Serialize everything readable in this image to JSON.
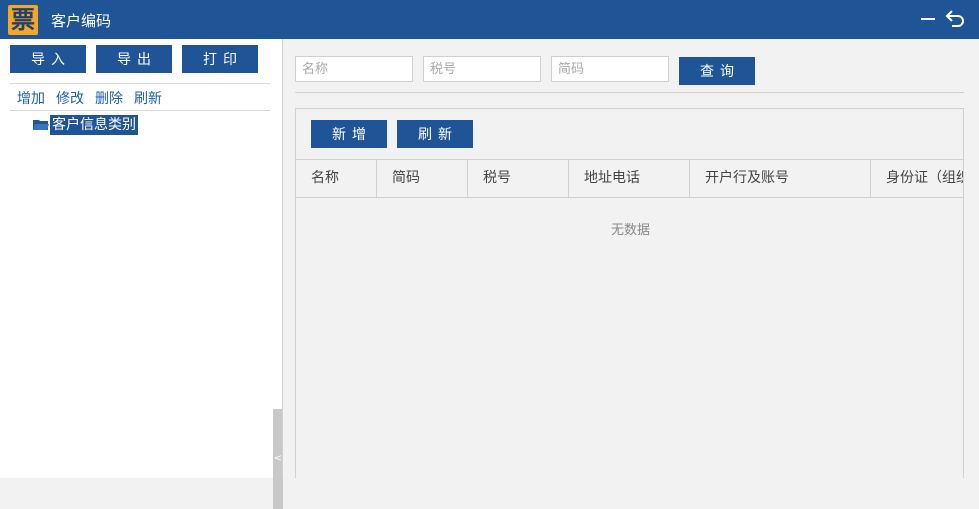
{
  "titlebar": {
    "logo_text": "票",
    "title": "客户编码",
    "minimize_icon": "minimize-icon",
    "back_icon": "return-icon"
  },
  "left_panel": {
    "buttons": {
      "import": "导入",
      "export": "导出",
      "print": "打印"
    },
    "links": {
      "add": "增加",
      "edit": "修改",
      "delete": "删除",
      "refresh": "刷新"
    },
    "tree": {
      "root_label": "客户信息类别",
      "icon": "folder-open-icon"
    },
    "collapse_label": "<"
  },
  "search": {
    "name_placeholder": "名称",
    "taxno_placeholder": "税号",
    "code_placeholder": "简码",
    "query_button": "查询"
  },
  "grid": {
    "new_button": "新增",
    "refresh_button": "刷新",
    "columns": [
      "名称",
      "简码",
      "税号",
      "地址电话",
      "开户行及账号",
      "身份证（组织"
    ],
    "empty_text": "无数据"
  },
  "colors": {
    "accent": "#1f5597",
    "link": "#1f5fa8",
    "background": "#f2f2f2",
    "logo": "#f5a623"
  }
}
